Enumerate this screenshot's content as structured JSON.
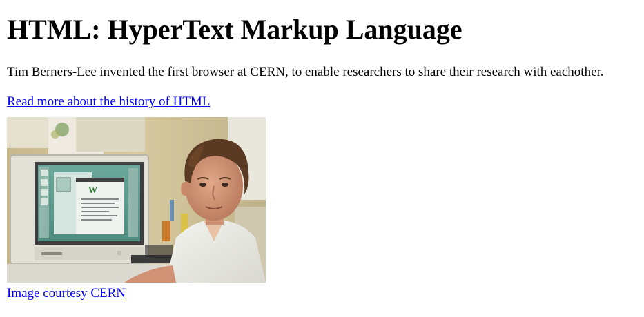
{
  "article": {
    "heading": "HTML: HyperText Markup Language",
    "intro": "Tim Berners-Lee invented the first browser at CERN, to enable researchers to share their research with eachother.",
    "more_link": "Read more about the history of HTML",
    "photo_alt": "Tim Berners-Lee at his NeXT computer",
    "credit_link": "Image courtesy CERN"
  },
  "colors": {
    "link": "#0000ee",
    "text": "#000000",
    "background": "#ffffff"
  }
}
